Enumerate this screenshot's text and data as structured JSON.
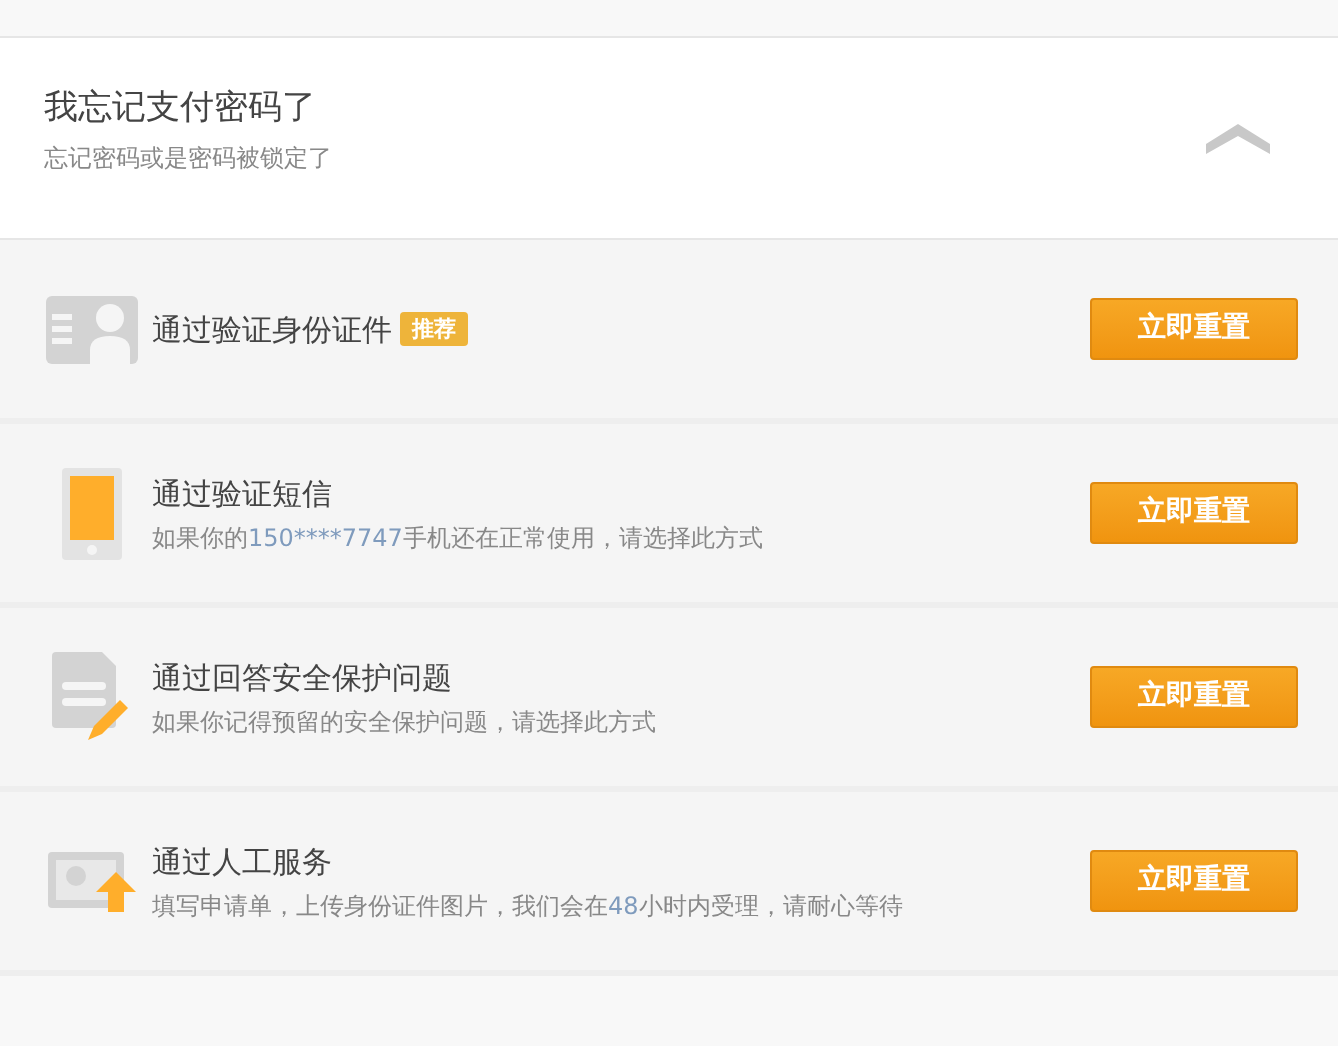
{
  "header": {
    "title": "我忘记支付密码了",
    "subtitle": "忘记密码或是密码被锁定了",
    "expanded": true
  },
  "options": [
    {
      "kind": "id-card",
      "title": "通过验证身份证件",
      "badge": "推荐",
      "button": "立即重置"
    },
    {
      "kind": "phone",
      "title": "通过验证短信",
      "description": [
        {
          "text": "如果你的",
          "highlight": false
        },
        {
          "text": "150****7747",
          "highlight": true
        },
        {
          "text": "手机还在正常使用，请选择此方式",
          "highlight": false
        }
      ],
      "button": "立即重置"
    },
    {
      "kind": "form",
      "title": "通过回答安全保护问题",
      "description": [
        {
          "text": "如果你记得预留的安全保护问题，请选择此方式",
          "highlight": false
        }
      ],
      "button": "立即重置"
    },
    {
      "kind": "upload",
      "title": "通过人工服务",
      "description": [
        {
          "text": "填写申请单，上传身份证件图片，我们会在",
          "highlight": false
        },
        {
          "text": "48",
          "highlight": true
        },
        {
          "text": "小时内受理，请耐心等待",
          "highlight": false
        }
      ],
      "button": "立即重置"
    }
  ]
}
